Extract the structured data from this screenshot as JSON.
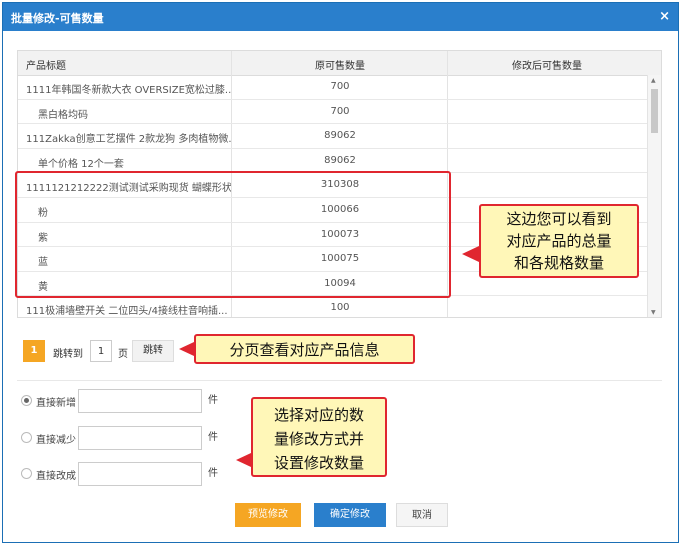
{
  "dialog": {
    "title": "批量修改-可售数量",
    "close": "×"
  },
  "table": {
    "headers": [
      "产品标题",
      "原可售数量",
      "修改后可售数量"
    ],
    "rows": [
      {
        "title": "1111年韩国冬新款大衣 OVERSIZE宽松过膝...",
        "qty": "700",
        "sub": false
      },
      {
        "title": "黑白格均码",
        "qty": "700",
        "sub": true
      },
      {
        "title": "111Zakka创意工艺摆件 2款龙狗 多肉植物微...",
        "qty": "89062",
        "sub": false
      },
      {
        "title": "单个价格 12个一套",
        "qty": "89062",
        "sub": true
      },
      {
        "title": "1111121212222测试测试采购现货 蝴蝶形状...",
        "qty": "310308",
        "sub": false
      },
      {
        "title": "粉",
        "qty": "100066",
        "sub": true
      },
      {
        "title": "紫",
        "qty": "100073",
        "sub": true
      },
      {
        "title": "蓝",
        "qty": "100075",
        "sub": true
      },
      {
        "title": "黄",
        "qty": "10094",
        "sub": true
      },
      {
        "title": "111极浦墙壁开关 二位四头/4接线柱音响插...",
        "qty": "100",
        "sub": false
      }
    ]
  },
  "annotations": {
    "table_note": [
      "这边您可以看到",
      "对应产品的总量",
      "和各规格数量"
    ],
    "pager_note": "分页查看对应产品信息",
    "options_note": [
      "选择对应的数",
      "量修改方式并",
      "设置修改数量"
    ]
  },
  "pager": {
    "current_page": "1",
    "jump_label": "跳转到",
    "jump_value": "1",
    "unit": "页",
    "jump_button": "跳转"
  },
  "options": [
    {
      "label": "直接新增",
      "unit": "件",
      "selected": true
    },
    {
      "label": "直接减少",
      "unit": "件",
      "selected": false
    },
    {
      "label": "直接改成",
      "unit": "件",
      "selected": false
    }
  ],
  "buttons": {
    "preview": "预览修改",
    "confirm": "确定修改",
    "cancel": "取消"
  },
  "colors": {
    "title_bar": "#2a7fcc",
    "accent_orange": "#f5a623",
    "annotation_border": "#e0262f",
    "annotation_fill": "#fff7b8"
  }
}
